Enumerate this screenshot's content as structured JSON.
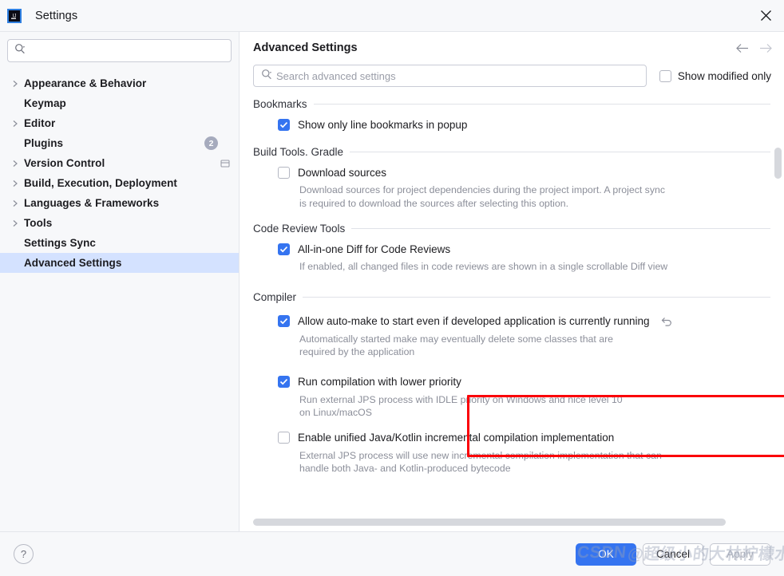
{
  "window": {
    "title": "Settings",
    "app_icon": "intellij-idea-icon",
    "close_icon": "close-icon"
  },
  "sidebar": {
    "search_placeholder": "",
    "search_icon": "search-icon",
    "items": [
      {
        "label": "Appearance & Behavior",
        "expandable": true,
        "selected": false
      },
      {
        "label": "Keymap",
        "expandable": false,
        "selected": false
      },
      {
        "label": "Editor",
        "expandable": true,
        "selected": false
      },
      {
        "label": "Plugins",
        "expandable": false,
        "selected": false,
        "badge": "2"
      },
      {
        "label": "Version Control",
        "expandable": true,
        "selected": false,
        "trailing_icon": "panel-icon"
      },
      {
        "label": "Build, Execution, Deployment",
        "expandable": true,
        "selected": false
      },
      {
        "label": "Languages & Frameworks",
        "expandable": true,
        "selected": false
      },
      {
        "label": "Tools",
        "expandable": true,
        "selected": false
      },
      {
        "label": "Settings Sync",
        "expandable": false,
        "selected": false
      },
      {
        "label": "Advanced Settings",
        "expandable": false,
        "selected": true
      }
    ]
  },
  "main": {
    "title": "Advanced Settings",
    "back_icon": "arrow-left-icon",
    "forward_icon": "arrow-right-icon",
    "search": {
      "placeholder": "Search advanced settings",
      "value": "",
      "icon": "search-icon"
    },
    "show_modified_only": {
      "label": "Show modified only",
      "checked": false
    },
    "groups": [
      {
        "title": "Bookmarks",
        "options": [
          {
            "label": "Show only line bookmarks in popup",
            "checked": true,
            "description": ""
          }
        ]
      },
      {
        "title": "Build Tools. Gradle",
        "options": [
          {
            "label": "Download sources",
            "checked": false,
            "description": "Download sources for project dependencies during the project import. A project sync is required to download the sources after selecting this option."
          }
        ]
      },
      {
        "title": "Code Review Tools",
        "options": [
          {
            "label": "All-in-one Diff for Code Reviews",
            "checked": true,
            "description": "If enabled, all changed files in code reviews are shown in a single scrollable Diff view"
          }
        ]
      },
      {
        "title": "Compiler",
        "options": [
          {
            "label": "Allow auto-make to start even if developed application is currently running",
            "checked": true,
            "description": "Automatically started make may eventually delete some classes that are required by the application",
            "revert_icon": "revert-icon",
            "highlighted": true
          },
          {
            "label": "Run compilation with lower priority",
            "checked": true,
            "description": "Run external JPS process with IDLE priority on Windows and nice level 10 on Linux/macOS"
          },
          {
            "label": "Enable unified Java/Kotlin incremental compilation implementation",
            "checked": false,
            "description": "External JPS process will use new incremental compilation implementation that can handle both Java- and Kotlin-produced bytecode"
          }
        ]
      }
    ]
  },
  "footer": {
    "help_label": "?",
    "ok_label": "OK",
    "cancel_label": "Cancel",
    "apply_label": "Apply"
  },
  "watermark": {
    "brand": "CSDN",
    "handle": "@超级小的大林柠檬水"
  },
  "colors": {
    "accent_blue": "#3574f0",
    "selection_blue": "#d4e2ff",
    "highlight_red": "#fb0007",
    "muted_text": "#8b8e99",
    "panel_bg": "#f7f8fa"
  }
}
